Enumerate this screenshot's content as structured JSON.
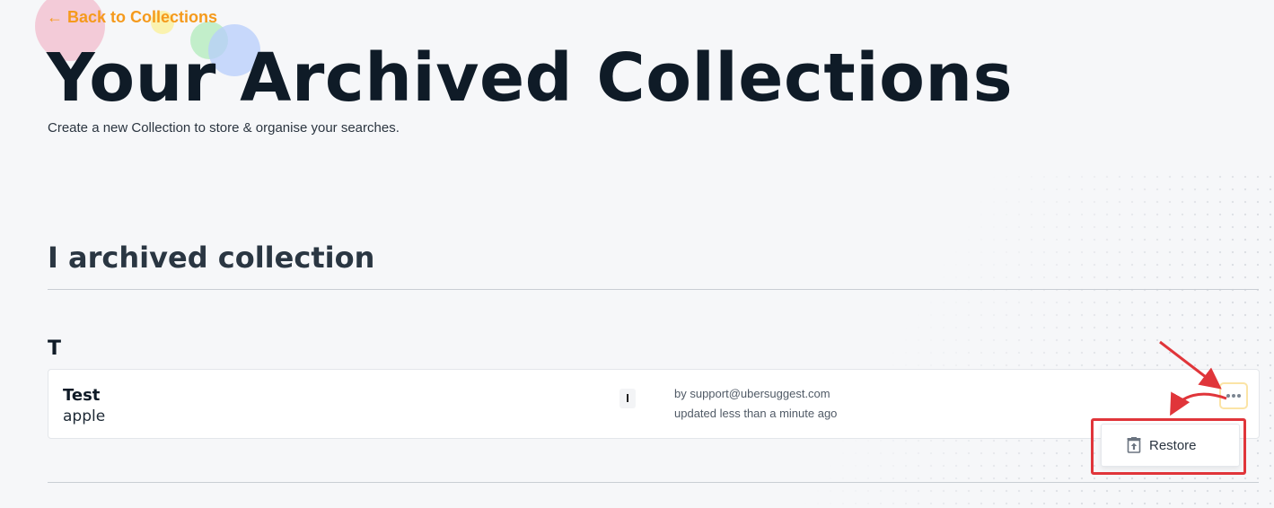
{
  "nav": {
    "back_link": "← Back to Collections"
  },
  "page": {
    "title": "Your Archived Collections",
    "subtitle": "Create a new Collection to store & organise your searches."
  },
  "section": {
    "count_label": "I archived collection"
  },
  "groups": [
    {
      "letter": "T",
      "collections": [
        {
          "name": "Test",
          "keyword": "apple",
          "count": "I",
          "owner": "by support@ubersuggest.com",
          "updated": "updated less than a minute ago"
        }
      ]
    }
  ],
  "menu": {
    "restore_label": "Restore",
    "restore_icon": "archive-restore-icon"
  },
  "icons": {
    "more": "more-horizontal-icon"
  },
  "colors": {
    "accent": "#f59a1c",
    "annotation": "#e0353a",
    "background": "#f6f7f9"
  }
}
